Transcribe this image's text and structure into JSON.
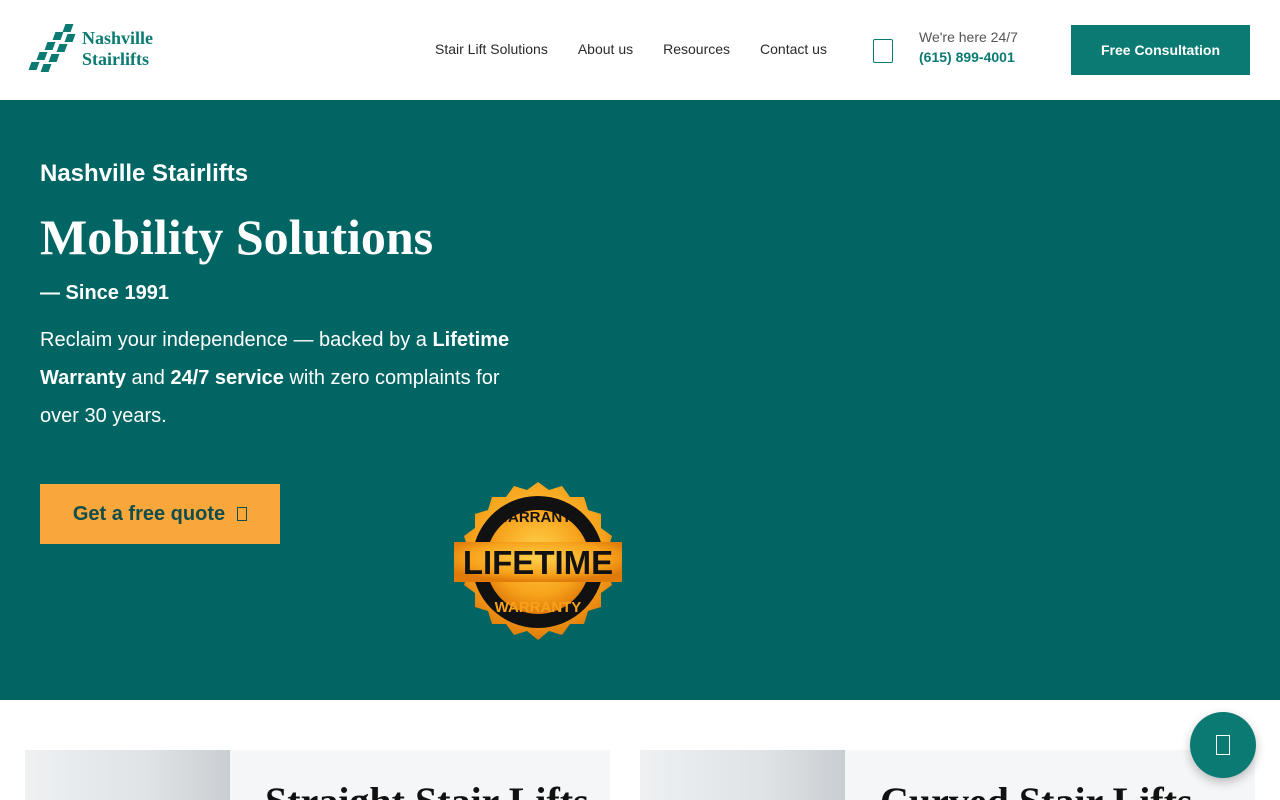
{
  "header": {
    "logo_line1": "Nashville",
    "logo_line2": "Stairlifts",
    "nav": [
      "Stair Lift Solutions",
      "About us",
      "Resources",
      "Contact us"
    ],
    "here_text": "We're here 24/7",
    "phone": "(615) 899-4001",
    "cta_label": "Free Consultation"
  },
  "hero": {
    "eyebrow": "Nashville Stairlifts",
    "title": "Mobility Solutions",
    "since": "— Since 1991",
    "desc_part1": "Reclaim your independence — backed by a ",
    "desc_bold1": "Lifetime Warranty",
    "desc_part2": " and ",
    "desc_bold2": "24/7 service",
    "desc_part3": " with zero complaints for over 30 years.",
    "quote_label": "Get a free quote",
    "badge_top": "WARRANTY",
    "badge_main": "LIFETIME",
    "badge_bottom": "WARRANTY"
  },
  "cards": [
    {
      "title": "Straight Stair Lifts"
    },
    {
      "title": "Curved Stair Lifts"
    }
  ],
  "icons": {
    "phone": "phone-icon",
    "chat": "chat-icon",
    "arrow": "arrow-icon"
  },
  "colors": {
    "brand": "#0b7a72",
    "hero_bg": "#006563",
    "accent": "#f9a63a"
  }
}
